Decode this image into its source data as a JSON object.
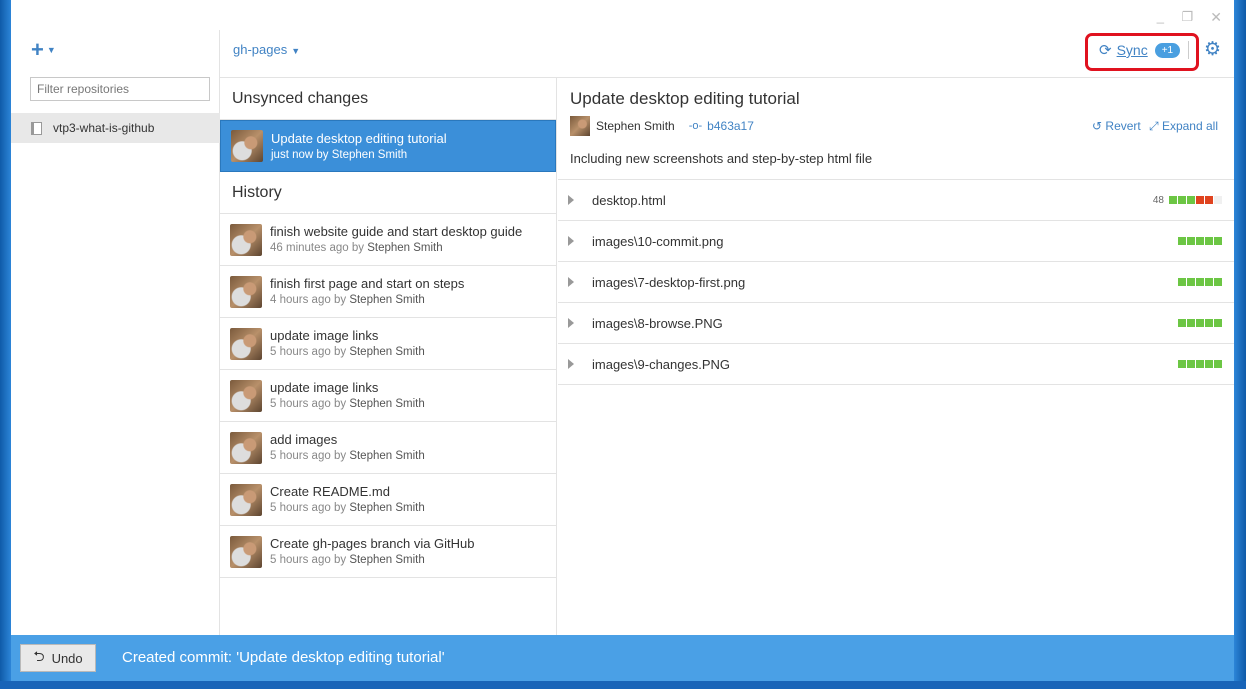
{
  "window": {
    "minimize": "_",
    "maximize": "❐",
    "close": "✕"
  },
  "left": {
    "add_icon": "+",
    "filter_placeholder": "Filter repositories",
    "repos": [
      {
        "name": "vtp3-what-is-github"
      }
    ]
  },
  "topbar": {
    "branch": "gh-pages",
    "sync_label": "Sync",
    "sync_badge": "+1"
  },
  "unsynced": {
    "heading": "Unsynced changes",
    "commits": [
      {
        "title": "Update desktop editing tutorial",
        "time": "just now",
        "by": "by",
        "author": "Stephen Smith"
      }
    ]
  },
  "history": {
    "heading": "History",
    "commits": [
      {
        "title": "finish website guide and start desktop guide",
        "time": "46 minutes ago",
        "by": "by",
        "author": "Stephen Smith"
      },
      {
        "title": "finish first page and start on steps",
        "time": "4 hours ago",
        "by": "by",
        "author": "Stephen Smith"
      },
      {
        "title": "update image links",
        "time": "5 hours ago",
        "by": "by",
        "author": "Stephen Smith"
      },
      {
        "title": "update image links",
        "time": "5 hours ago",
        "by": "by",
        "author": "Stephen Smith"
      },
      {
        "title": "add images",
        "time": "5 hours ago",
        "by": "by",
        "author": "Stephen Smith"
      },
      {
        "title": "Create README.md",
        "time": "5 hours ago",
        "by": "by",
        "author": "Stephen Smith"
      },
      {
        "title": "Create gh-pages branch via GitHub",
        "time": "5 hours ago",
        "by": "by",
        "author": "Stephen Smith"
      }
    ]
  },
  "detail": {
    "title": "Update desktop editing tutorial",
    "author": "Stephen Smith",
    "sha": "b463a17",
    "revert": "Revert",
    "expand": "Expand all",
    "description": "Including new screenshots and step-by-step html file",
    "files": [
      {
        "name": "desktop.html",
        "count": "48"
      },
      {
        "name": "images\\10-commit.png",
        "count": ""
      },
      {
        "name": "images\\7-desktop-first.png",
        "count": ""
      },
      {
        "name": "images\\8-browse.PNG",
        "count": ""
      },
      {
        "name": "images\\9-changes.PNG",
        "count": ""
      }
    ]
  },
  "status": {
    "undo": "Undo",
    "message": "Created commit: 'Update desktop editing tutorial'"
  },
  "colors": {
    "accent": "#4183c4",
    "status_bar": "#4aa0e6",
    "selected_row": "#3b8fd9",
    "highlight_box": "#e0121f"
  }
}
